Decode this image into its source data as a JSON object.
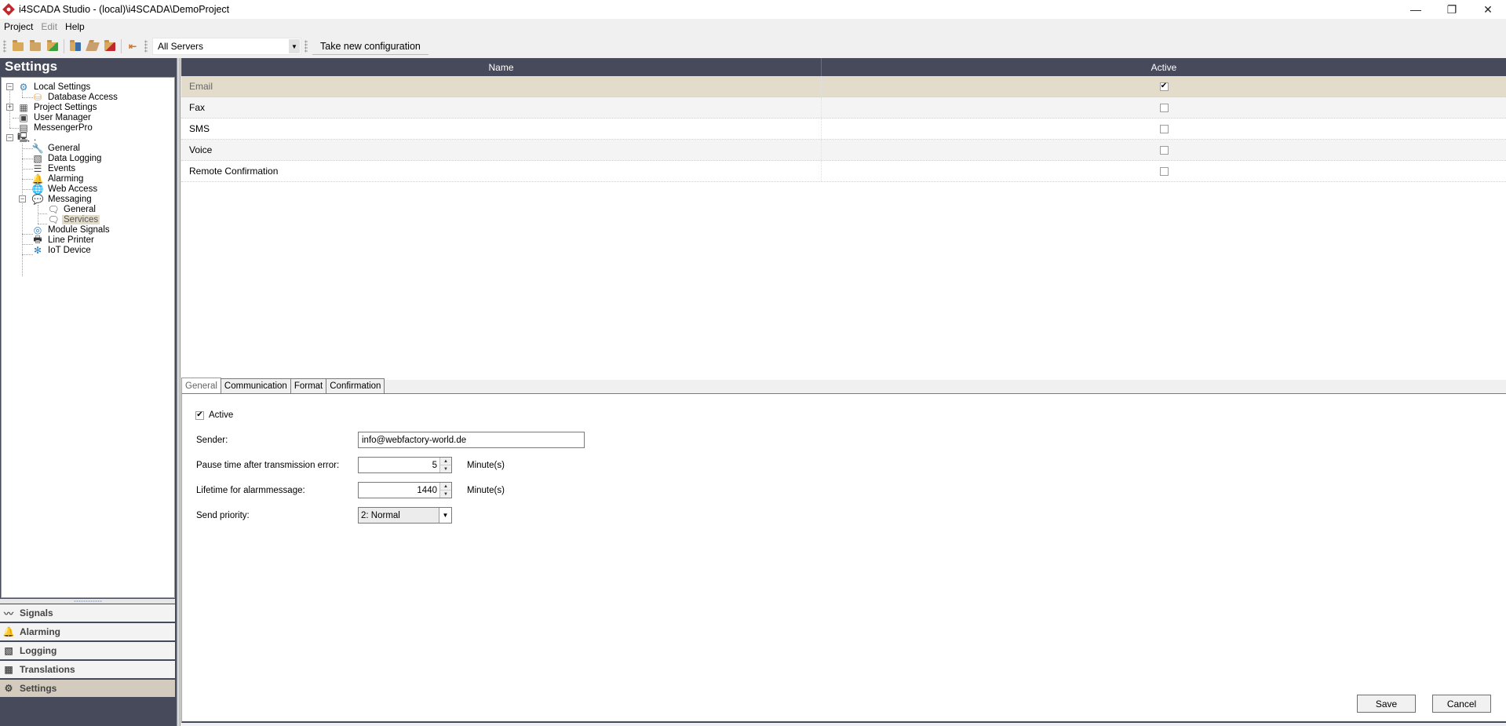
{
  "window": {
    "title": "i4SCADA Studio - (local)\\i4SCADA\\DemoProject",
    "controls": [
      "minimize",
      "restore",
      "close"
    ]
  },
  "menu": {
    "items": [
      {
        "label": "Project",
        "enabled": true
      },
      {
        "label": "Edit",
        "enabled": false
      },
      {
        "label": "Help",
        "enabled": true
      }
    ]
  },
  "toolbar": {
    "icons": [
      "new-project-icon",
      "open-project-icon",
      "import-project-icon",
      "deploy-icon",
      "clean-icon",
      "delete-project-icon",
      "exit-icon"
    ],
    "server_select": "All Servers",
    "take_config_label": "Take new configuration"
  },
  "sidebar": {
    "title": "Settings",
    "tree": [
      {
        "label": "Local Settings",
        "icon": "gear-circle-icon",
        "expanded": true
      },
      {
        "label": "Database Access",
        "icon": "database-icon"
      },
      {
        "label": "Project Settings",
        "icon": "project-settings-icon",
        "expanded": false
      },
      {
        "label": "User Manager",
        "icon": "user-manager-icon"
      },
      {
        "label": "MessengerPro",
        "icon": "messenger-icon"
      },
      {
        "label": ".",
        "icon": "server-icon",
        "expanded": true
      },
      {
        "label": "General",
        "icon": "wrench-icon"
      },
      {
        "label": "Data Logging",
        "icon": "data-logging-icon"
      },
      {
        "label": "Events",
        "icon": "events-icon"
      },
      {
        "label": "Alarming",
        "icon": "bell-icon"
      },
      {
        "label": "Web Access",
        "icon": "globe-icon"
      },
      {
        "label": "Messaging",
        "icon": "chat-icon",
        "expanded": true
      },
      {
        "label": "General",
        "icon": "chat-search-icon"
      },
      {
        "label": "Services",
        "icon": "chat-gear-icon",
        "selected": true
      },
      {
        "label": "Module Signals",
        "icon": "signal-wave-icon"
      },
      {
        "label": "Line Printer",
        "icon": "printer-icon"
      },
      {
        "label": "IoT Device",
        "icon": "iot-network-icon"
      }
    ],
    "nav": [
      {
        "label": "Signals",
        "icon": "signals-icon"
      },
      {
        "label": "Alarming",
        "icon": "bell-icon"
      },
      {
        "label": "Logging",
        "icon": "logging-icon"
      },
      {
        "label": "Translations",
        "icon": "translations-icon"
      },
      {
        "label": "Settings",
        "icon": "gear-icon",
        "active": true
      }
    ]
  },
  "grid": {
    "columns": [
      "Name",
      "Active"
    ],
    "rows": [
      {
        "name": "Email",
        "active": true,
        "selected": true
      },
      {
        "name": "Fax",
        "active": false
      },
      {
        "name": "SMS",
        "active": false
      },
      {
        "name": "Voice",
        "active": false
      },
      {
        "name": "Remote Confirmation",
        "active": false
      }
    ]
  },
  "detail": {
    "tabs": [
      {
        "label": "General",
        "active": true
      },
      {
        "label": "Communication"
      },
      {
        "label": "Format"
      },
      {
        "label": "Confirmation"
      }
    ],
    "active_label": "Active",
    "active_checked": true,
    "sender_label": "Sender:",
    "sender_value": "info@webfactory-world.de",
    "pause_label": "Pause time after transmission error:",
    "pause_value": "5",
    "pause_unit": "Minute(s)",
    "lifetime_label": "Lifetime for alarmmessage:",
    "lifetime_value": "1440",
    "lifetime_unit": "Minute(s)",
    "priority_label": "Send priority:",
    "priority_value": "2: Normal",
    "save_label": "Save",
    "cancel_label": "Cancel"
  },
  "glyphs": {
    "minimize": "—",
    "restore": "❐",
    "close": "✕",
    "dropdown": "▼",
    "spin_up": "▲",
    "spin_down": "▼",
    "check": "✔",
    "minus": "−",
    "plus": "+"
  }
}
